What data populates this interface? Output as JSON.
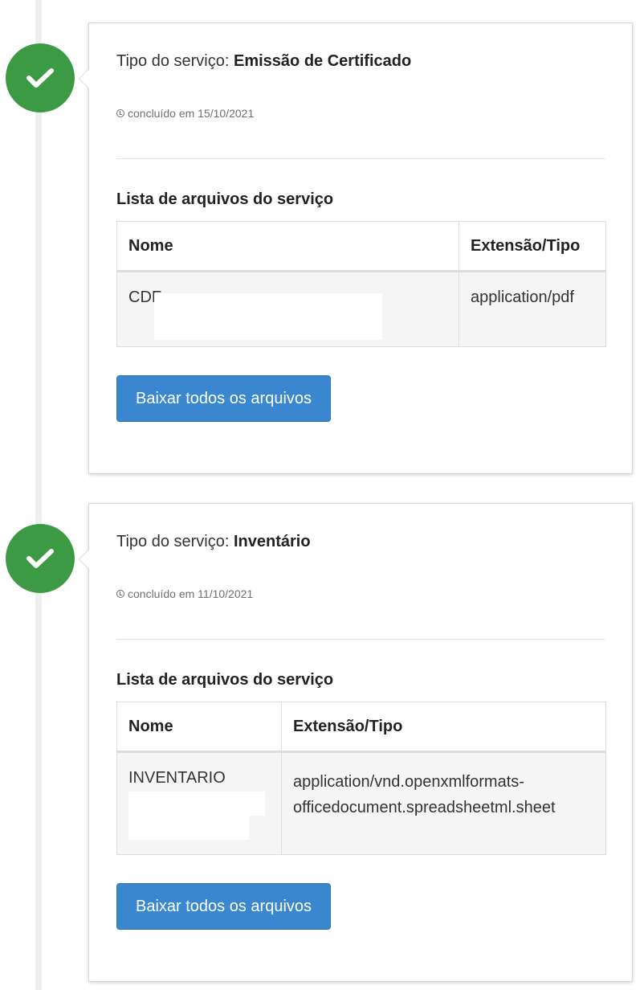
{
  "services": [
    {
      "type_label": "Tipo do serviço: ",
      "type_value": "Emissão de Certificado",
      "completed_text": "concluído em 15/10/2021",
      "files_heading": "Lista de arquivos do serviço",
      "table": {
        "headers": [
          "Nome",
          "Extensão/Tipo"
        ],
        "rows": [
          {
            "name": "CDF",
            "type": "application/pdf"
          }
        ]
      },
      "download_label": "Baixar todos os arquivos"
    },
    {
      "type_label": "Tipo do serviço: ",
      "type_value": "Inventário",
      "completed_text": "concluído em 11/10/2021",
      "files_heading": "Lista de arquivos do serviço",
      "table": {
        "headers": [
          "Nome",
          "Extensão/Tipo"
        ],
        "rows": [
          {
            "name": "INVENTARIO",
            "type": "application/vnd.openxmlformats-officedocument.spreadsheetml.sheet"
          }
        ]
      },
      "download_label": "Baixar todos os arquivos"
    }
  ],
  "colors": {
    "badge": "#3d9a44",
    "button": "#3a87cf"
  },
  "icons": [
    "check-icon",
    "clock-icon"
  ]
}
